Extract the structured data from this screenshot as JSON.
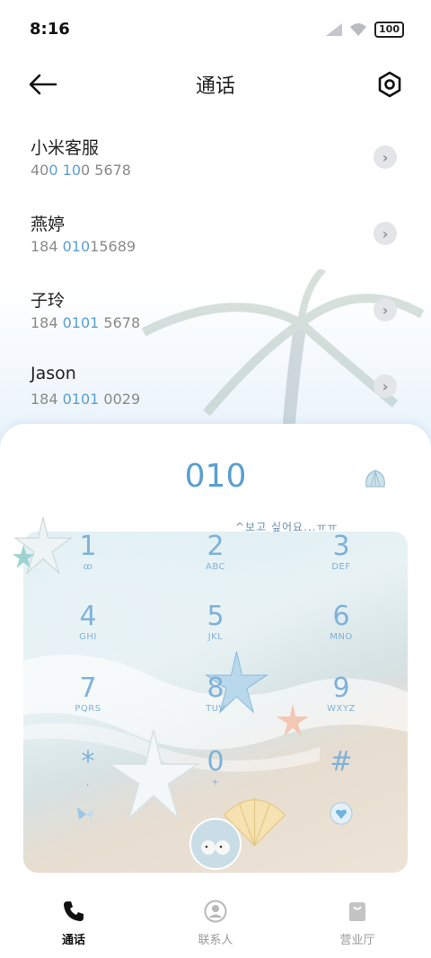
{
  "status": {
    "time": "8:16",
    "battery": "100"
  },
  "header": {
    "title": "通话"
  },
  "contacts": [
    {
      "name": "小米客服",
      "n1": "40",
      "h1": "0",
      "n2": " ",
      "h2": "10",
      "n3": "0 5678"
    },
    {
      "name": "燕婷",
      "n1": "184 ",
      "h1": "010",
      "n2": "15689",
      "h2": "",
      "n3": ""
    },
    {
      "name": "子玲",
      "n1": "184 ",
      "h1": "0101",
      "n2": " 5678",
      "h2": "",
      "n3": ""
    },
    {
      "name": "Jason",
      "n1": "184 ",
      "h1": "0101",
      "n2": " 0029",
      "h2": "",
      "n3": ""
    }
  ],
  "dialer": {
    "input": "010",
    "caption": "^보고 싶어요...ㅠㅠ",
    "keys": [
      {
        "digit": "1",
        "letters": "ꝏ"
      },
      {
        "digit": "2",
        "letters": "ABC"
      },
      {
        "digit": "3",
        "letters": "DEF"
      },
      {
        "digit": "4",
        "letters": "GHI"
      },
      {
        "digit": "5",
        "letters": "JKL"
      },
      {
        "digit": "6",
        "letters": "MNO"
      },
      {
        "digit": "7",
        "letters": "PQRS"
      },
      {
        "digit": "8",
        "letters": "TUV"
      },
      {
        "digit": "9",
        "letters": "WXYZ"
      },
      {
        "digit": "*",
        "letters": ","
      },
      {
        "digit": "0",
        "letters": "+"
      },
      {
        "digit": "#",
        "letters": ""
      }
    ]
  },
  "nav": {
    "calls": "通话",
    "contacts": "联系人",
    "store": "营业厅"
  },
  "colors": {
    "accent": "#5a9fd1",
    "key": "#7fb2d9"
  }
}
